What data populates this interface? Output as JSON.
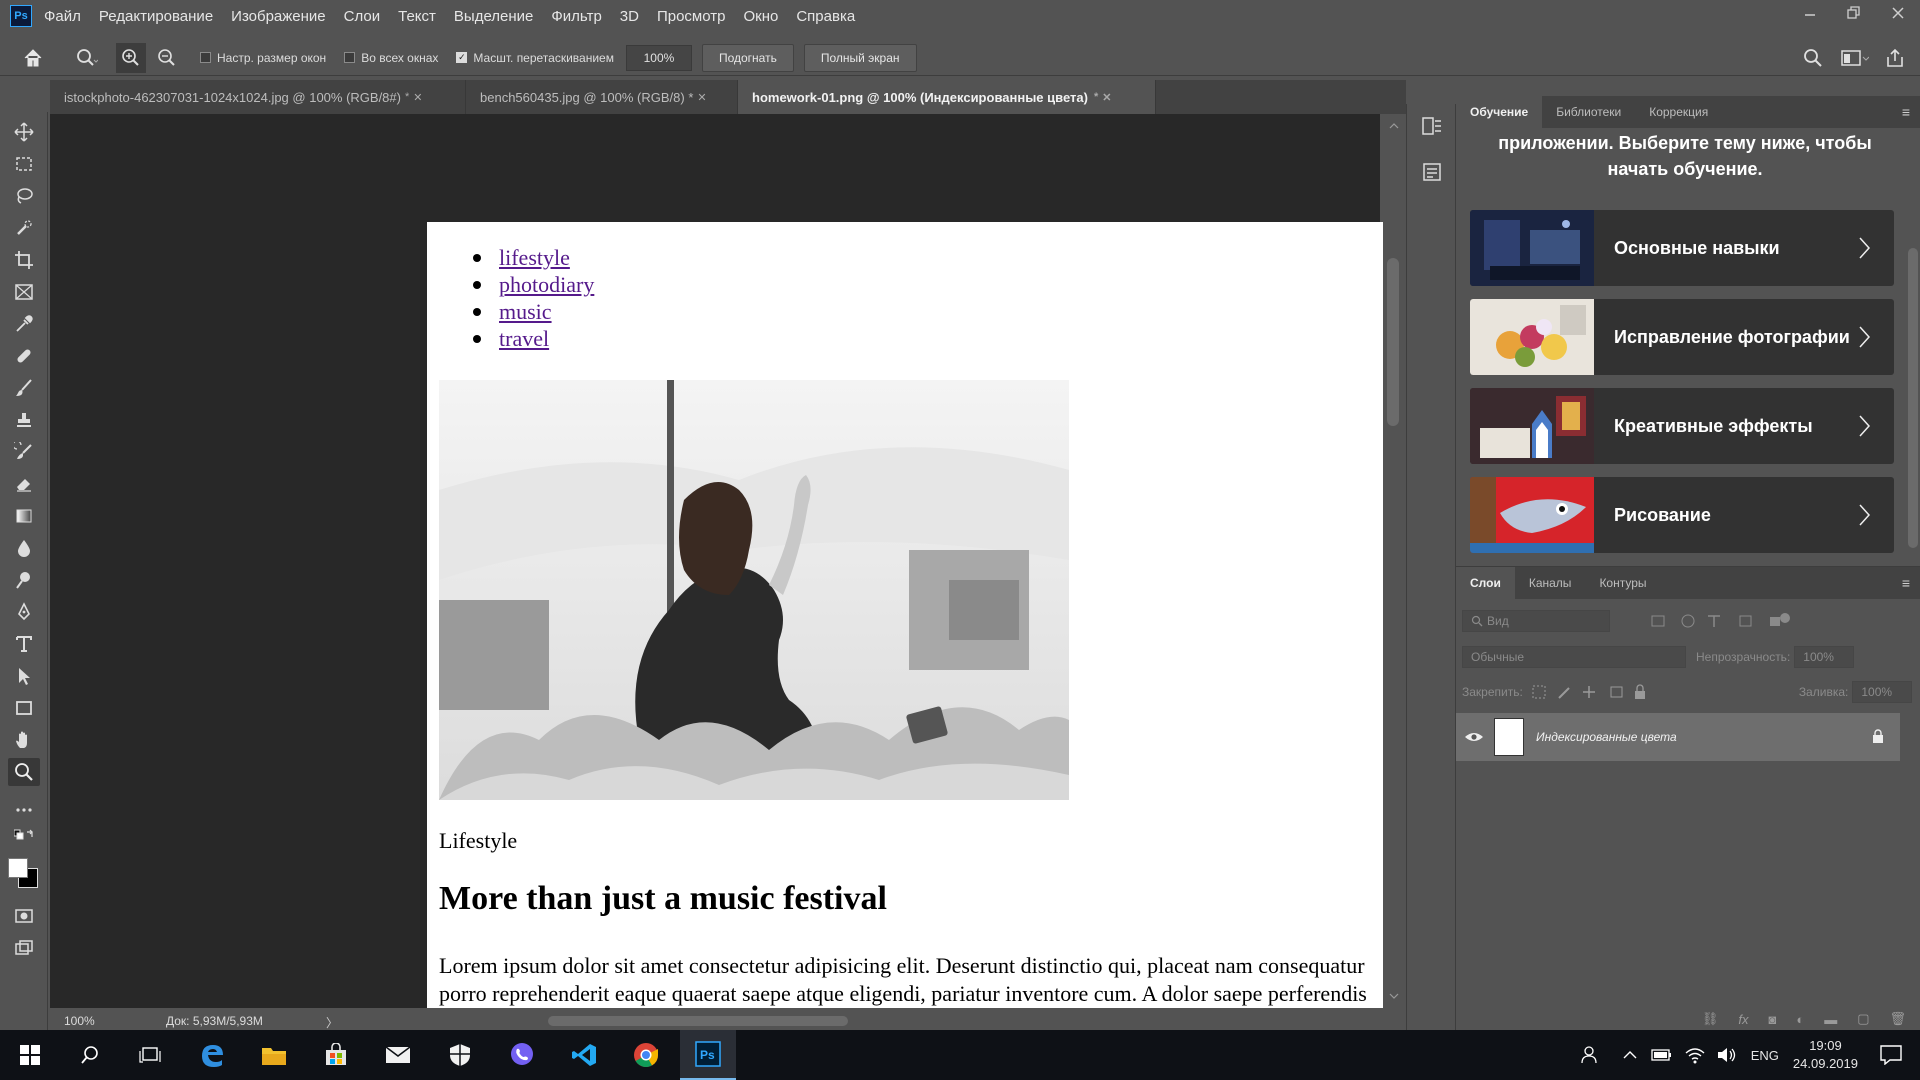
{
  "menubar": {
    "logo": "Ps",
    "items": [
      "Файл",
      "Редактирование",
      "Изображение",
      "Слои",
      "Текст",
      "Выделение",
      "Фильтр",
      "3D",
      "Просмотр",
      "Окно",
      "Справка"
    ]
  },
  "options": {
    "resize_windows": "Настр. размер окон",
    "all_windows": "Во всех окнах",
    "scrubby_zoom": "Масшт. перетаскиванием",
    "zoom_value": "100%",
    "fit_button": "Подогнать",
    "fullscreen_button": "Полный экран"
  },
  "tabs": [
    {
      "title": "istockphoto-462307031-1024x1024.jpg @ 100% (RGB/8#)",
      "mark": "*"
    },
    {
      "title": "bench560435.jpg @ 100% (RGB/8) *",
      "mark": ""
    },
    {
      "title": "homework-01.png @ 100% (Индексированные цвета)",
      "mark": "*"
    }
  ],
  "document": {
    "nav_links": [
      "lifestyle",
      "photodiary",
      "music",
      "travel"
    ],
    "category": "Lifestyle",
    "headline": "More than just a music festival",
    "body_line1": "Lorem ipsum dolor sit amet consectetur adipisicing elit. Deserunt distinctio qui, placeat nam consequatur",
    "body_line2": "porro reprehenderit eaque quaerat saepe atque eligendi, pariatur inventore cum. A dolor saepe perferendis"
  },
  "status": {
    "zoom": "100%",
    "doc_size": "Док: 5,93M/5,93M",
    "arrow": "〉"
  },
  "learn_panel": {
    "tabs": [
      "Обучение",
      "Библиотеки",
      "Коррекция"
    ],
    "intro_line1": "приложении. Выберите тему ниже, чтобы",
    "intro_line2": "начать обучение.",
    "cards": [
      "Основные навыки",
      "Исправление фотографии",
      "Креативные эффекты",
      "Рисование"
    ]
  },
  "layers_panel": {
    "tabs": [
      "Слои",
      "Каналы",
      "Контуры"
    ],
    "search_placeholder": "Вид",
    "blend_mode": "Обычные",
    "opacity_label": "Непрозрачность:",
    "opacity_value": "100%",
    "lock_label": "Закрепить:",
    "fill_label": "Заливка:",
    "fill_value": "100%",
    "layer_name": "Индексированные цвета"
  },
  "taskbar": {
    "language": "ENG",
    "time": "19:09",
    "date": "24.09.2019"
  },
  "colors": {
    "accent": "#31a8ff",
    "link": "#551a8b",
    "panel": "#535353",
    "canvas_bg": "#282828"
  }
}
